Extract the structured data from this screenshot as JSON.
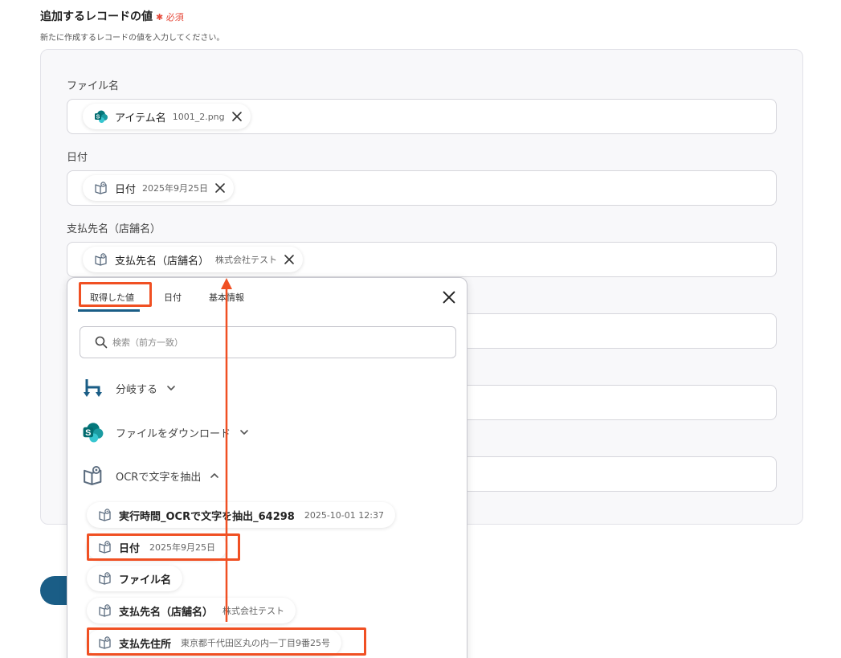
{
  "header": {
    "title": "追加するレコードの値",
    "required": "✱ 必須",
    "description": "新たに作成するレコードの値を入力してください。"
  },
  "fields": [
    {
      "label": "ファイル名",
      "chip_name": "アイテム名",
      "chip_value": "1001_2.png"
    },
    {
      "label": "日付",
      "chip_name": "日付",
      "chip_value": "2025年9月25日"
    },
    {
      "label": "支払先名（店舗名）",
      "chip_name": "支払先名（店舗名）",
      "chip_value": "株式会社テスト"
    }
  ],
  "popup": {
    "tabs": [
      "取得した値",
      "日付",
      "基本情報"
    ],
    "search_placeholder": "検索（前方一致）",
    "groups": [
      "分岐する",
      "ファイルをダウンロード",
      "OCRで文字を抽出"
    ],
    "options": [
      {
        "name": "実行時間_OCRで文字を抽出_64298",
        "value": "2025-10-01 12:37"
      },
      {
        "name": "日付",
        "value": "2025年9月25日"
      },
      {
        "name": "ファイル名",
        "value": ""
      },
      {
        "name": "支払先名（店舗名）",
        "value": "株式会社テスト"
      },
      {
        "name": "支払先住所",
        "value": "東京都千代田区丸の内一丁目9番25号"
      }
    ]
  },
  "colors": {
    "accent": "#1a5d86",
    "highlight": "#f05023",
    "required": "#e64a3b"
  }
}
